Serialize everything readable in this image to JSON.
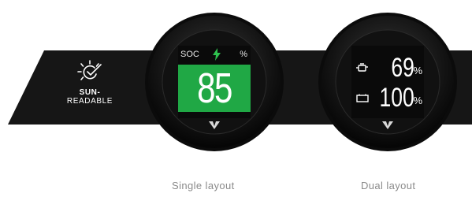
{
  "badge": {
    "icon": "sun-icon",
    "line1": "SUN-",
    "line2": "READABLE"
  },
  "single_layout": {
    "header_left": "SOC",
    "header_icon": "lightning-bolt-icon",
    "header_right": "%",
    "value": "85",
    "panel_color": "#20a845",
    "caption": "Single layout"
  },
  "dual_layout": {
    "rows": [
      {
        "icon": "engine-icon",
        "value": "69",
        "unit": "%"
      },
      {
        "icon": "battery-icon",
        "value": "100",
        "unit": "%"
      }
    ],
    "caption": "Dual layout"
  },
  "colors": {
    "banner": "#161616",
    "bezel": "#1b1b1b",
    "background": "#ffffff"
  }
}
